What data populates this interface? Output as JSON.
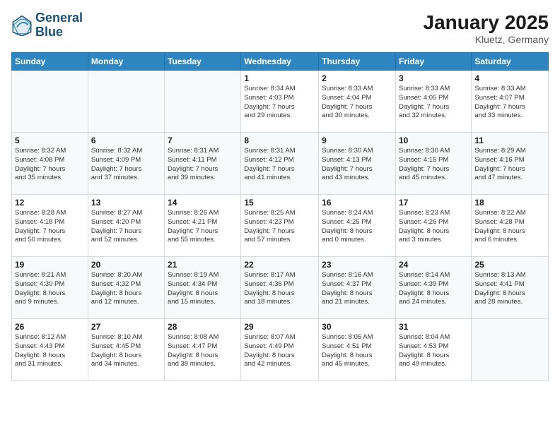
{
  "logo": {
    "line1": "General",
    "line2": "Blue"
  },
  "title": "January 2025",
  "subtitle": "Kluetz, Germany",
  "weekdays": [
    "Sunday",
    "Monday",
    "Tuesday",
    "Wednesday",
    "Thursday",
    "Friday",
    "Saturday"
  ],
  "weeks": [
    [
      {
        "day": "",
        "info": ""
      },
      {
        "day": "",
        "info": ""
      },
      {
        "day": "",
        "info": ""
      },
      {
        "day": "1",
        "info": "Sunrise: 8:34 AM\nSunset: 4:03 PM\nDaylight: 7 hours\nand 29 minutes."
      },
      {
        "day": "2",
        "info": "Sunrise: 8:33 AM\nSunset: 4:04 PM\nDaylight: 7 hours\nand 30 minutes."
      },
      {
        "day": "3",
        "info": "Sunrise: 8:33 AM\nSunset: 4:05 PM\nDaylight: 7 hours\nand 32 minutes."
      },
      {
        "day": "4",
        "info": "Sunrise: 8:33 AM\nSunset: 4:07 PM\nDaylight: 7 hours\nand 33 minutes."
      }
    ],
    [
      {
        "day": "5",
        "info": "Sunrise: 8:32 AM\nSunset: 4:08 PM\nDaylight: 7 hours\nand 35 minutes."
      },
      {
        "day": "6",
        "info": "Sunrise: 8:32 AM\nSunset: 4:09 PM\nDaylight: 7 hours\nand 37 minutes."
      },
      {
        "day": "7",
        "info": "Sunrise: 8:31 AM\nSunset: 4:11 PM\nDaylight: 7 hours\nand 39 minutes."
      },
      {
        "day": "8",
        "info": "Sunrise: 8:31 AM\nSunset: 4:12 PM\nDaylight: 7 hours\nand 41 minutes."
      },
      {
        "day": "9",
        "info": "Sunrise: 8:30 AM\nSunset: 4:13 PM\nDaylight: 7 hours\nand 43 minutes."
      },
      {
        "day": "10",
        "info": "Sunrise: 8:30 AM\nSunset: 4:15 PM\nDaylight: 7 hours\nand 45 minutes."
      },
      {
        "day": "11",
        "info": "Sunrise: 8:29 AM\nSunset: 4:16 PM\nDaylight: 7 hours\nand 47 minutes."
      }
    ],
    [
      {
        "day": "12",
        "info": "Sunrise: 8:28 AM\nSunset: 4:18 PM\nDaylight: 7 hours\nand 50 minutes."
      },
      {
        "day": "13",
        "info": "Sunrise: 8:27 AM\nSunset: 4:20 PM\nDaylight: 7 hours\nand 52 minutes."
      },
      {
        "day": "14",
        "info": "Sunrise: 8:26 AM\nSunset: 4:21 PM\nDaylight: 7 hours\nand 55 minutes."
      },
      {
        "day": "15",
        "info": "Sunrise: 8:25 AM\nSunset: 4:23 PM\nDaylight: 7 hours\nand 57 minutes."
      },
      {
        "day": "16",
        "info": "Sunrise: 8:24 AM\nSunset: 4:25 PM\nDaylight: 8 hours\nand 0 minutes."
      },
      {
        "day": "17",
        "info": "Sunrise: 8:23 AM\nSunset: 4:26 PM\nDaylight: 8 hours\nand 3 minutes."
      },
      {
        "day": "18",
        "info": "Sunrise: 8:22 AM\nSunset: 4:28 PM\nDaylight: 8 hours\nand 6 minutes."
      }
    ],
    [
      {
        "day": "19",
        "info": "Sunrise: 8:21 AM\nSunset: 4:30 PM\nDaylight: 8 hours\nand 9 minutes."
      },
      {
        "day": "20",
        "info": "Sunrise: 8:20 AM\nSunset: 4:32 PM\nDaylight: 8 hours\nand 12 minutes."
      },
      {
        "day": "21",
        "info": "Sunrise: 8:19 AM\nSunset: 4:34 PM\nDaylight: 8 hours\nand 15 minutes."
      },
      {
        "day": "22",
        "info": "Sunrise: 8:17 AM\nSunset: 4:36 PM\nDaylight: 8 hours\nand 18 minutes."
      },
      {
        "day": "23",
        "info": "Sunrise: 8:16 AM\nSunset: 4:37 PM\nDaylight: 8 hours\nand 21 minutes."
      },
      {
        "day": "24",
        "info": "Sunrise: 8:14 AM\nSunset: 4:39 PM\nDaylight: 8 hours\nand 24 minutes."
      },
      {
        "day": "25",
        "info": "Sunrise: 8:13 AM\nSunset: 4:41 PM\nDaylight: 8 hours\nand 28 minutes."
      }
    ],
    [
      {
        "day": "26",
        "info": "Sunrise: 8:12 AM\nSunset: 4:43 PM\nDaylight: 8 hours\nand 31 minutes."
      },
      {
        "day": "27",
        "info": "Sunrise: 8:10 AM\nSunset: 4:45 PM\nDaylight: 8 hours\nand 34 minutes."
      },
      {
        "day": "28",
        "info": "Sunrise: 8:08 AM\nSunset: 4:47 PM\nDaylight: 8 hours\nand 38 minutes."
      },
      {
        "day": "29",
        "info": "Sunrise: 8:07 AM\nSunset: 4:49 PM\nDaylight: 8 hours\nand 42 minutes."
      },
      {
        "day": "30",
        "info": "Sunrise: 8:05 AM\nSunset: 4:51 PM\nDaylight: 8 hours\nand 45 minutes."
      },
      {
        "day": "31",
        "info": "Sunrise: 8:04 AM\nSunset: 4:53 PM\nDaylight: 8 hours\nand 49 minutes."
      },
      {
        "day": "",
        "info": ""
      }
    ]
  ]
}
